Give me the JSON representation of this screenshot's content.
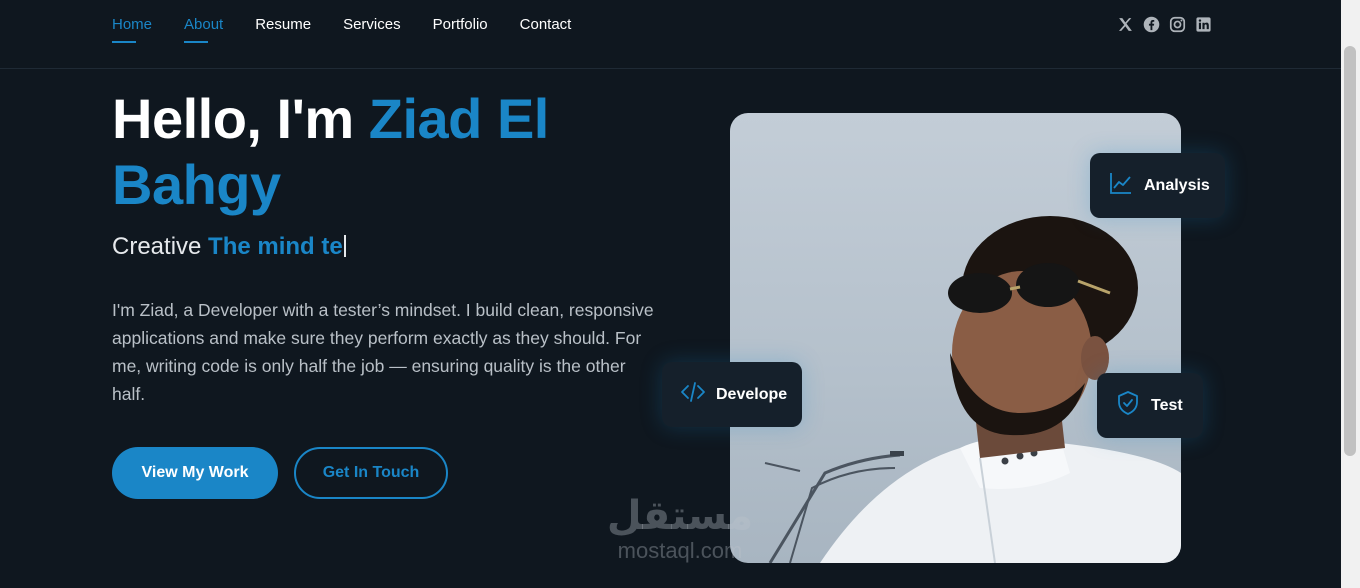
{
  "nav": {
    "links": [
      {
        "label": "Home",
        "active": true
      },
      {
        "label": "About",
        "active": true
      },
      {
        "label": "Resume",
        "active": false
      },
      {
        "label": "Services",
        "active": false
      },
      {
        "label": "Portfolio",
        "active": false
      },
      {
        "label": "Contact",
        "active": false
      }
    ],
    "socials": [
      "x-icon",
      "facebook-icon",
      "instagram-icon",
      "linkedin-icon"
    ]
  },
  "hero": {
    "greeting": "Hello, I'm ",
    "name": "Ziad El Bahgy",
    "subtitle_prefix": "Creative ",
    "subtitle_typed": "The mind te",
    "description": "I'm Ziad, a Developer with a tester’s mindset. I build clean, responsive applications and make sure they perform exactly as they should. For me, writing code is only half the job — ensuring quality is the other half.",
    "primary_button": "View My Work",
    "secondary_button": "Get In Touch"
  },
  "badges": {
    "analysis": {
      "label": "Analysis",
      "icon": "line-chart-icon"
    },
    "develope": {
      "label": "Develope",
      "icon": "code-icon"
    },
    "test": {
      "label": "Test",
      "icon": "shield-check-icon"
    }
  },
  "watermark": {
    "arabic": "مستقل",
    "latin": "mostaql.com"
  },
  "colors": {
    "accent": "#1a86c7",
    "background": "#0f171f",
    "card": "#15202b"
  }
}
